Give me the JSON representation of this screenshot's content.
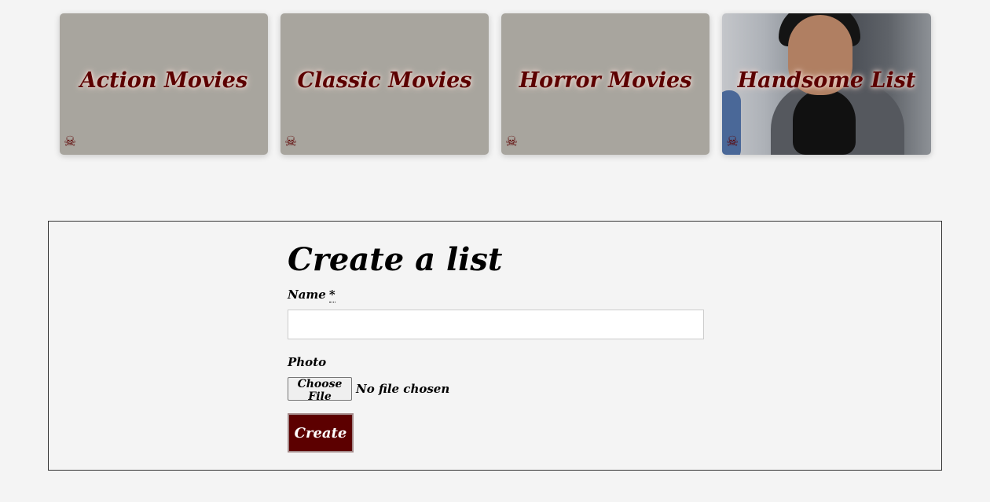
{
  "lists": [
    {
      "title": "Action Movies",
      "icon": "skull-crossbones-icon"
    },
    {
      "title": "Classic Movies",
      "icon": "skull-crossbones-icon"
    },
    {
      "title": "Horror Movies",
      "icon": "skull-crossbones-icon"
    },
    {
      "title": "Handsome List",
      "icon": "skull-crossbones-icon"
    }
  ],
  "skull_glyph": "☠",
  "form": {
    "title": "Create a list",
    "name_label": "Name",
    "required_marker": "*",
    "name_value": "",
    "photo_label": "Photo",
    "file_button_label": "Choose File",
    "file_status": "No file chosen",
    "submit_label": "Create"
  },
  "colors": {
    "accent": "#5c0000",
    "page_background": "#f4f4f4",
    "card_background": "#a8a59e"
  }
}
